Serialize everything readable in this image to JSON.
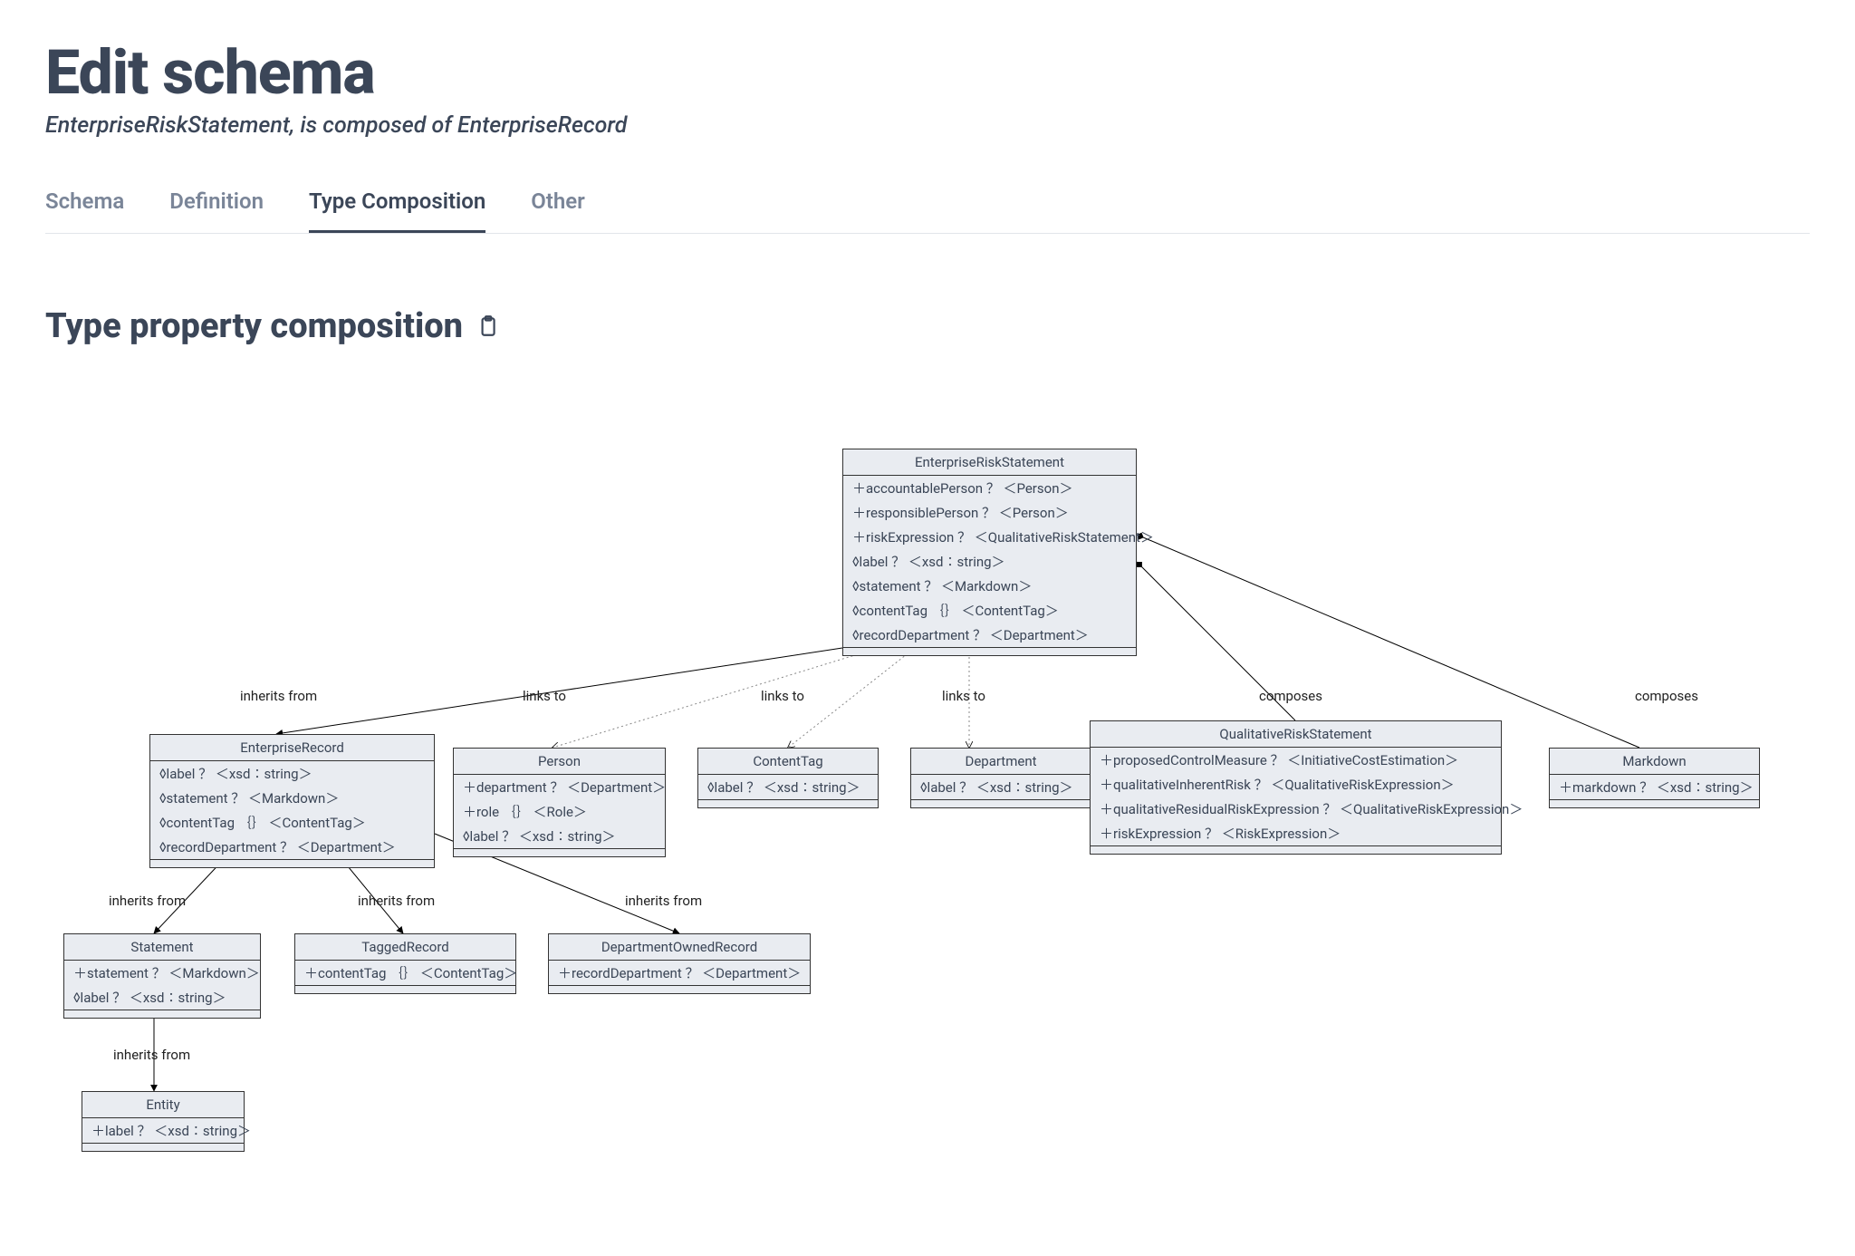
{
  "header": {
    "title": "Edit schema",
    "subtitle": "EnterpriseRiskStatement, is composed of EnterpriseRecord"
  },
  "tabs": {
    "schema": "Schema",
    "definition": "Definition",
    "type_composition": "Type Composition",
    "other": "Other"
  },
  "section": {
    "title": "Type property composition"
  },
  "nodes": {
    "enterpriseRiskStatement": {
      "title": "EnterpriseRiskStatement",
      "props": [
        "＋accountablePerson ？ ＜Person＞",
        "＋responsiblePerson ？ ＜Person＞",
        "＋riskExpression ？ ＜QualitativeRiskStatement＞",
        "◊label ？ ＜xsd∶string＞",
        "◊statement ？ ＜Markdown＞",
        "◊contentTag ｛｝ ＜ContentTag＞",
        "◊recordDepartment ？ ＜Department＞"
      ]
    },
    "enterpriseRecord": {
      "title": "EnterpriseRecord",
      "props": [
        "◊label ？ ＜xsd∶string＞",
        "◊statement ？ ＜Markdown＞",
        "◊contentTag ｛｝ ＜ContentTag＞",
        "◊recordDepartment ？ ＜Department＞"
      ]
    },
    "person": {
      "title": "Person",
      "props": [
        "＋department ？ ＜Department＞",
        "＋role ｛｝ ＜Role＞",
        "◊label ？ ＜xsd∶string＞"
      ]
    },
    "contentTag": {
      "title": "ContentTag",
      "props": [
        "◊label ？ ＜xsd∶string＞"
      ]
    },
    "department": {
      "title": "Department",
      "props": [
        "◊label ？ ＜xsd∶string＞"
      ]
    },
    "qualitativeRiskStatement": {
      "title": "QualitativeRiskStatement",
      "props": [
        "＋proposedControlMeasure ？ ＜InitiativeCostEstimation＞",
        "＋qualitativeInherentRisk ？ ＜QualitativeRiskExpression＞",
        "＋qualitativeResidualRiskExpression ？ ＜QualitativeRiskExpression＞",
        "＋riskExpression ？ ＜RiskExpression＞"
      ]
    },
    "markdown": {
      "title": "Markdown",
      "props": [
        "＋markdown ？ ＜xsd∶string＞"
      ]
    },
    "statement": {
      "title": "Statement",
      "props": [
        "＋statement ？ ＜Markdown＞",
        "◊label ？ ＜xsd∶string＞"
      ]
    },
    "taggedRecord": {
      "title": "TaggedRecord",
      "props": [
        "＋contentTag ｛｝ ＜ContentTag＞"
      ]
    },
    "departmentOwnedRecord": {
      "title": "DepartmentOwnedRecord",
      "props": [
        "＋recordDepartment ？ ＜Department＞"
      ]
    },
    "entity": {
      "title": "Entity",
      "props": [
        "＋label ？ ＜xsd∶string＞"
      ]
    }
  },
  "edges": {
    "inherits": "inherits from",
    "links": "links to",
    "composes": "composes"
  }
}
